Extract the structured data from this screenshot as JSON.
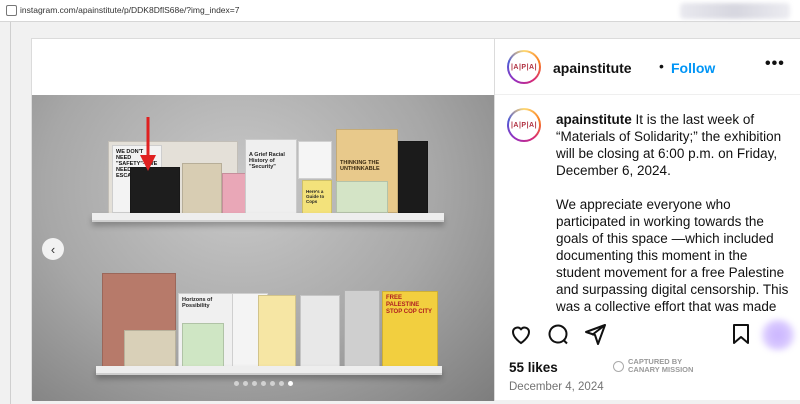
{
  "browser": {
    "url": "instagram.com/apainstitute/p/DDK8DflS68e/?img_index=7"
  },
  "post": {
    "username": "apainstitute",
    "follow_label": "Follow",
    "separator": "•",
    "more_icon": "more-horizontal-icon",
    "avatar_logo": "|A|P|A|",
    "caption_paragraph_1": "It is the last week of “Materials of Solidarity;” the exhibition will be closing at 6:00 p.m. on Friday, December 6, 2024.",
    "caption_paragraph_2": "We appreciate everyone who participated in working towards the goals of this space —which included documenting this moment in the student movement for a free Palestine and surpassing digital censorship. This was a collective effort that was made",
    "likes": "55 likes",
    "date": "December 4, 2024",
    "watermark_line_1": "CAPTURED BY",
    "watermark_line_2": "CANARY MISSION",
    "carousel": {
      "count": 7,
      "active_index": 7
    }
  },
  "photo": {
    "zines": {
      "z1": "WE DON'T NEED \"SAFETY\"—WE NEED TO ESCALATE",
      "z2": "A Grief Racial History of \"Security\"",
      "z3": "THINKING THE UNTHINKABLE",
      "z4": "Here's a Guide to Cops",
      "z5": "FREE PALESTINE STOP COP CITY",
      "z6": "Horizons of Possibility"
    }
  },
  "colors": {
    "accent": "#0095f6",
    "annotation_arrow": "#e02020"
  }
}
